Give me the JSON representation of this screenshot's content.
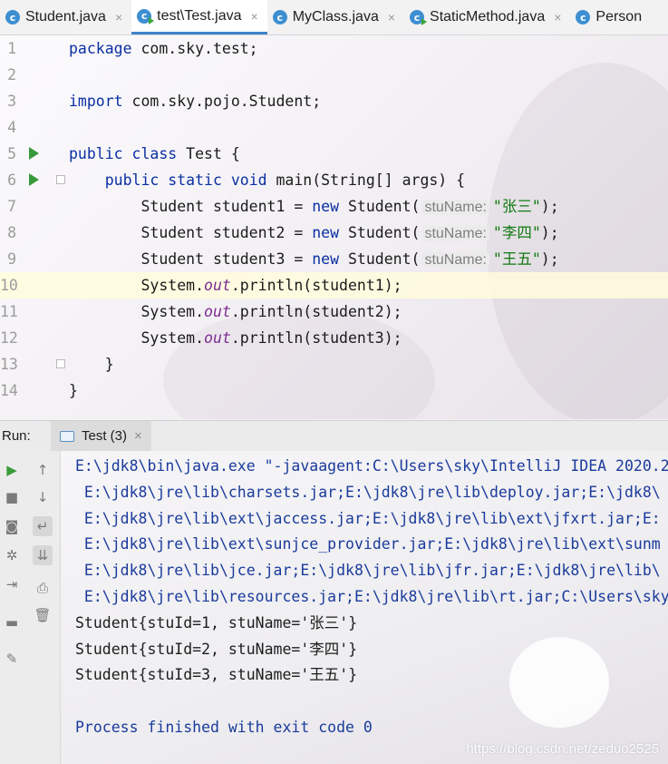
{
  "tabs": [
    {
      "label": "Student.java",
      "icon": "class-icon",
      "active": false
    },
    {
      "label": "test\\Test.java",
      "icon": "runnable-class-icon",
      "active": true
    },
    {
      "label": "MyClass.java",
      "icon": "class-icon",
      "active": false
    },
    {
      "label": "StaticMethod.java",
      "icon": "runnable-class-icon",
      "active": false
    },
    {
      "label": "Person",
      "icon": "class-icon",
      "active": false
    }
  ],
  "tab_close_glyph": "×",
  "editor": {
    "current_line": 10,
    "lines": [
      {
        "n": "1",
        "parts": [
          {
            "t": "package",
            "c": "kw"
          },
          {
            "t": " com.sky.test;"
          }
        ]
      },
      {
        "n": "2",
        "parts": []
      },
      {
        "n": "3",
        "parts": [
          {
            "t": "import",
            "c": "kw"
          },
          {
            "t": " com.sky.pojo.Student;"
          }
        ]
      },
      {
        "n": "4",
        "parts": []
      },
      {
        "n": "5",
        "run": true,
        "parts": [
          {
            "t": "public class",
            "c": "kw"
          },
          {
            "t": " Test {"
          }
        ]
      },
      {
        "n": "6",
        "run": true,
        "fold": true,
        "parts": [
          {
            "t": "    "
          },
          {
            "t": "public static void",
            "c": "kw"
          },
          {
            "t": " main(String[] args) {"
          }
        ]
      },
      {
        "n": "7",
        "parts": [
          {
            "t": "        Student student1 = "
          },
          {
            "t": "new",
            "c": "kw"
          },
          {
            "t": " Student("
          },
          {
            "t": "stuName:",
            "c": "hint"
          },
          {
            "t": "\"张三\"",
            "c": "str"
          },
          {
            "t": ");"
          }
        ]
      },
      {
        "n": "8",
        "parts": [
          {
            "t": "        Student student2 = "
          },
          {
            "t": "new",
            "c": "kw"
          },
          {
            "t": " Student("
          },
          {
            "t": "stuName:",
            "c": "hint"
          },
          {
            "t": "\"李四\"",
            "c": "str"
          },
          {
            "t": ");"
          }
        ]
      },
      {
        "n": "9",
        "parts": [
          {
            "t": "        Student student3 = "
          },
          {
            "t": "new",
            "c": "kw"
          },
          {
            "t": " Student("
          },
          {
            "t": "stuName:",
            "c": "hint"
          },
          {
            "t": "\"王五\"",
            "c": "str"
          },
          {
            "t": ");"
          }
        ]
      },
      {
        "n": "10",
        "parts": [
          {
            "t": "        System."
          },
          {
            "t": "out",
            "c": "fld"
          },
          {
            "t": ".println(student1);"
          }
        ]
      },
      {
        "n": "11",
        "parts": [
          {
            "t": "        System."
          },
          {
            "t": "out",
            "c": "fld"
          },
          {
            "t": ".println(student2);"
          }
        ]
      },
      {
        "n": "12",
        "parts": [
          {
            "t": "        System."
          },
          {
            "t": "out",
            "c": "fld"
          },
          {
            "t": ".println(student3);"
          }
        ]
      },
      {
        "n": "13",
        "fold": true,
        "parts": [
          {
            "t": "    }"
          }
        ]
      },
      {
        "n": "14",
        "parts": [
          {
            "t": "}"
          }
        ]
      }
    ]
  },
  "run_panel": {
    "label": "Run:",
    "tab_label": "Test (3)",
    "close_glyph": "×",
    "tools": [
      {
        "name": "rerun-icon",
        "glyph": "▶"
      },
      {
        "name": "stop-icon",
        "glyph": "■"
      },
      {
        "name": "camera-icon",
        "glyph": "◙"
      },
      {
        "name": "settings-icon",
        "glyph": "✲"
      },
      {
        "name": "exit-icon",
        "glyph": "⇥"
      },
      {
        "name": "layout-icon",
        "glyph": "▬"
      },
      {
        "name": "pin-icon",
        "glyph": "✎"
      },
      {
        "name": "up-arrow-icon",
        "glyph": "↑"
      },
      {
        "name": "down-arrow-icon",
        "glyph": "↓"
      },
      {
        "name": "soft-wrap-icon",
        "glyph": "↵"
      },
      {
        "name": "scroll-to-end-icon",
        "glyph": "⇊"
      },
      {
        "name": "print-icon",
        "glyph": "⎙"
      },
      {
        "name": "trash-icon",
        "glyph": "🗑"
      }
    ],
    "output": [
      {
        "text": "E:\\jdk8\\bin\\java.exe \"-javaagent:C:\\Users\\sky\\IntelliJ IDEA 2020.2",
        "style": "blue"
      },
      {
        "text": " E:\\jdk8\\jre\\lib\\charsets.jar;E:\\jdk8\\jre\\lib\\deploy.jar;E:\\jdk8\\",
        "style": "blue"
      },
      {
        "text": " E:\\jdk8\\jre\\lib\\ext\\jaccess.jar;E:\\jdk8\\jre\\lib\\ext\\jfxrt.jar;E:",
        "style": "blue"
      },
      {
        "text": " E:\\jdk8\\jre\\lib\\ext\\sunjce_provider.jar;E:\\jdk8\\jre\\lib\\ext\\sunm",
        "style": "blue"
      },
      {
        "text": " E:\\jdk8\\jre\\lib\\jce.jar;E:\\jdk8\\jre\\lib\\jfr.jar;E:\\jdk8\\jre\\lib\\",
        "style": "blue"
      },
      {
        "text": " E:\\jdk8\\jre\\lib\\resources.jar;E:\\jdk8\\jre\\lib\\rt.jar;C:\\Users\\sky",
        "style": "blue"
      },
      {
        "text": "Student{stuId=1, stuName='张三'}",
        "style": "plain"
      },
      {
        "text": "Student{stuId=2, stuName='李四'}",
        "style": "plain"
      },
      {
        "text": "Student{stuId=3, stuName='王五'}",
        "style": "plain"
      },
      {
        "text": "",
        "style": "plain"
      },
      {
        "text": "Process finished with exit code 0",
        "style": "blue"
      }
    ],
    "watermark": "https://blog.csdn.net/zeduo2525"
  }
}
